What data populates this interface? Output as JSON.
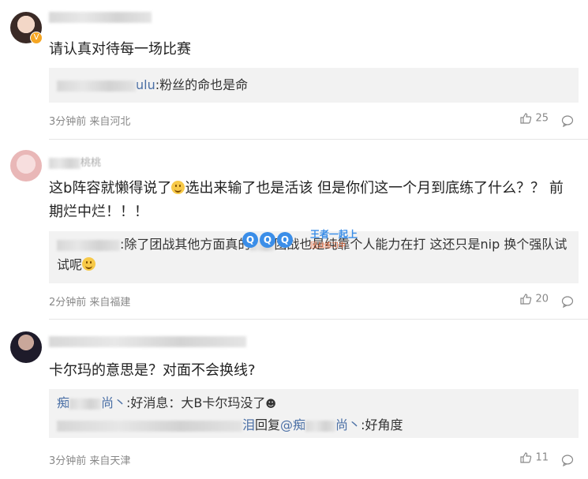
{
  "comments": [
    {
      "text": "请认真对待每一场比赛",
      "reply": {
        "name_suffix": "ulu",
        "text": ":粉丝的命也是命"
      },
      "meta": "3分钟前 来自河北",
      "likes": "25"
    },
    {
      "username_visible": "桃桃",
      "text_part1": "这b阵容就懒得说了",
      "text_part2": "选出来输了也是活该 但是你们这一个月到底练了什么？？ 前期烂中烂！！！",
      "reply": {
        "text_a": ":除了团战其他方面真的",
        "text_b": "团战也是纯靠个人能力在打 这还只是nip 换个强队试试呢"
      },
      "meta": "2分钟前 来自福建",
      "likes": "20"
    },
    {
      "text": "卡尔玛的意思是？对面不会换线?",
      "reply1": {
        "name_a": "痴",
        "name_b": "尚丶",
        "text": ":好消息：大B卡尔玛没了"
      },
      "reply2": {
        "name_end": "泪",
        "reply_word": "回复",
        "at_a": "@痴",
        "at_b": "尚丶",
        "text": ":好角度"
      },
      "meta": "3分钟前 来自天津",
      "likes": "11"
    }
  ],
  "watermark": {
    "line1": "王者一起上",
    "line2": "团战练习中"
  }
}
